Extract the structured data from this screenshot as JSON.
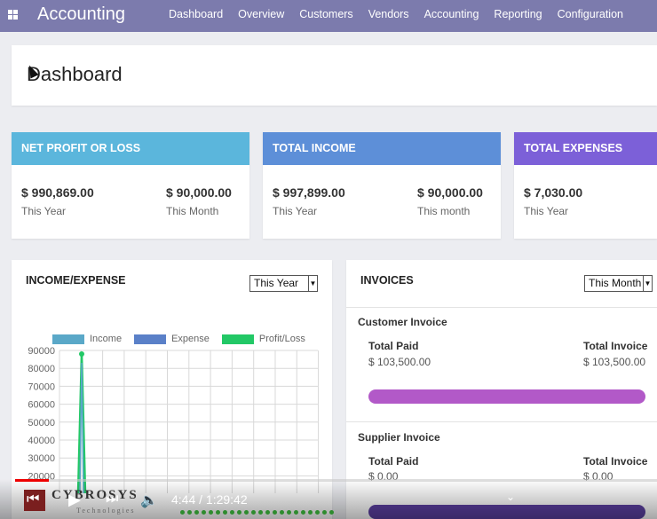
{
  "navbar": {
    "brand": "Accounting",
    "items": [
      "Dashboard",
      "Overview",
      "Customers",
      "Vendors",
      "Accounting",
      "Reporting",
      "Configuration"
    ]
  },
  "page": {
    "title": "Dashboard"
  },
  "cards": [
    {
      "title": "NET PROFIT OR LOSS",
      "color": "#5bb6dc",
      "left_value": "$ 990,869.00",
      "left_label": "This Year",
      "right_value": "$ 90,000.00",
      "right_label": "This Month"
    },
    {
      "title": "TOTAL INCOME",
      "color": "#5d8fd8",
      "left_value": "$ 997,899.00",
      "left_label": "This Year",
      "right_value": "$ 90,000.00",
      "right_label": "This month"
    },
    {
      "title": "TOTAL EXPENSES",
      "color": "#7c60d8",
      "left_value": "$ 7,030.00",
      "left_label": "This Year"
    }
  ],
  "income_expense": {
    "title": "INCOME/EXPENSE",
    "period": "This Year",
    "legend": [
      {
        "label": "Income",
        "color": "#5aa8c8"
      },
      {
        "label": "Expense",
        "color": "#5a80c8"
      },
      {
        "label": "Profit/Loss",
        "color": "#22c866"
      }
    ]
  },
  "chart_data": {
    "type": "line",
    "ylim": [
      0,
      90000
    ],
    "y_ticks": [
      "90000",
      "80000",
      "70000",
      "60000",
      "50000",
      "40000",
      "30000",
      "20000"
    ],
    "series": [
      {
        "name": "Income",
        "color": "#5aa8c8"
      },
      {
        "name": "Expense",
        "color": "#5a80c8"
      },
      {
        "name": "Profit/Loss",
        "color": "#22c866",
        "peak": 88000
      }
    ]
  },
  "invoices": {
    "title": "INVOICES",
    "period": "This Month",
    "customer": {
      "title": "Customer Invoice",
      "paid_label": "Total Paid",
      "paid_value": "$ 103,500.00",
      "total_label": "Total Invoice",
      "total_value": "$ 103,500.00",
      "bar_color": "#b259c8",
      "paid_fraction": 1.0
    },
    "supplier": {
      "title": "Supplier Invoice",
      "paid_label": "Total Paid",
      "paid_value": "$ 0.00",
      "total_label": "Total Invoice",
      "total_value": "$ 0.00",
      "bar_color": "#5b3fa0"
    }
  },
  "video": {
    "brand": "CYBROSYS",
    "brand_sub": "Technologies",
    "time": "4:44 / 1:29:42",
    "progress_fraction": 0.053
  }
}
